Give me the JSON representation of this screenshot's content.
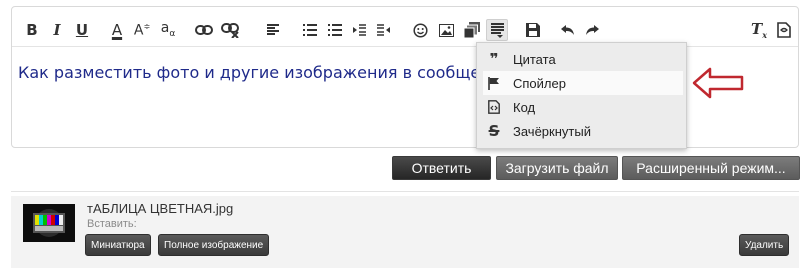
{
  "toolbar": {
    "icons": [
      "bold-icon",
      "italic-icon",
      "underline-icon",
      "text-color-icon",
      "font-size-icon",
      "font-family-icon",
      "link-icon",
      "unlink-icon",
      "align-icon",
      "bulleted-list-icon",
      "numbered-list-icon",
      "outdent-icon",
      "indent-icon",
      "smiley-icon",
      "image-icon",
      "media-icon",
      "insert-block-icon",
      "save-draft-icon",
      "undo-icon",
      "redo-icon",
      "remove-format-icon",
      "toggle-bbcode-icon"
    ]
  },
  "editor": {
    "content_text": "Как разместить фото и другие изображения в сообщен"
  },
  "dropdown": {
    "items": [
      {
        "icon": "quote-icon",
        "label": "Цитата"
      },
      {
        "icon": "flag-icon",
        "label": "Спойлер"
      },
      {
        "icon": "code-icon",
        "label": "Код"
      },
      {
        "icon": "strikethrough-icon",
        "label": "Зачёркнутый"
      }
    ]
  },
  "actions": {
    "reply": "Ответить",
    "upload": "Загрузить файл",
    "advanced": "Расширенный режим..."
  },
  "attachment": {
    "filename": "тАБЛИЦА ЦВЕТНАЯ.jpg",
    "insert_label": "Вставить:",
    "thumbnail_button": "Миниатюра",
    "full_image_button": "Полное изображение",
    "delete_button": "Удалить"
  },
  "colors": {
    "content_text": "#1f2a8a",
    "annotation_arrow": "#c0282f",
    "primary_button": "#333333"
  }
}
